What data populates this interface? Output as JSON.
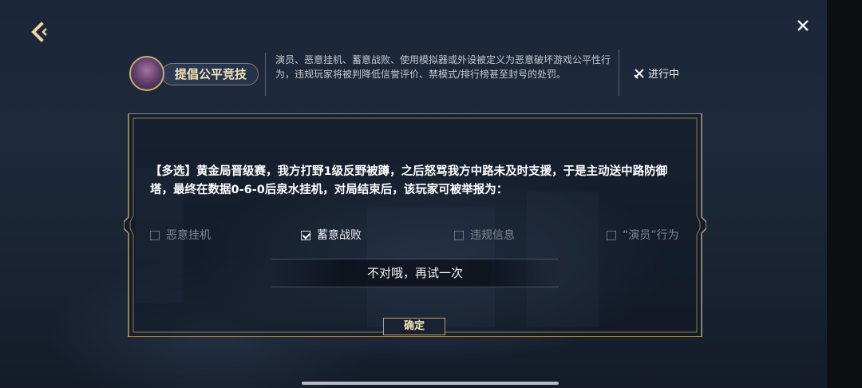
{
  "banner": {
    "title": "提倡公平竞技",
    "description": "演员、恶意挂机、蓄意战败、使用模拟器或外设被定义为恶意破坏游戏公平性行为，违规玩家将被判降低信誉评价、禁模式/排行榜甚至封号的处罚。",
    "status": "进行中"
  },
  "quiz": {
    "question": "【多选】黄金局晋级赛，我方打野1级反野被蹲，之后怒骂我方中路未及时支援，于是主动送中路防御塔，最终在数据0-6-0后泉水挂机，对局结束后，该玩家可被举报为：",
    "options": [
      {
        "label": "恶意挂机",
        "checked": false
      },
      {
        "label": "蓄意战败",
        "checked": true
      },
      {
        "label": "违规信息",
        "checked": false
      },
      {
        "label": "“演员”行为",
        "checked": false
      }
    ],
    "feedback": "不对哦，再试一次",
    "confirm_label": "确定"
  },
  "colors": {
    "gold": "#b9a16c",
    "gold_text": "#f2e2b5"
  },
  "icons": {
    "back": "back-chevron-icon",
    "close": "close-icon",
    "status": "crossed-swords-icon"
  }
}
